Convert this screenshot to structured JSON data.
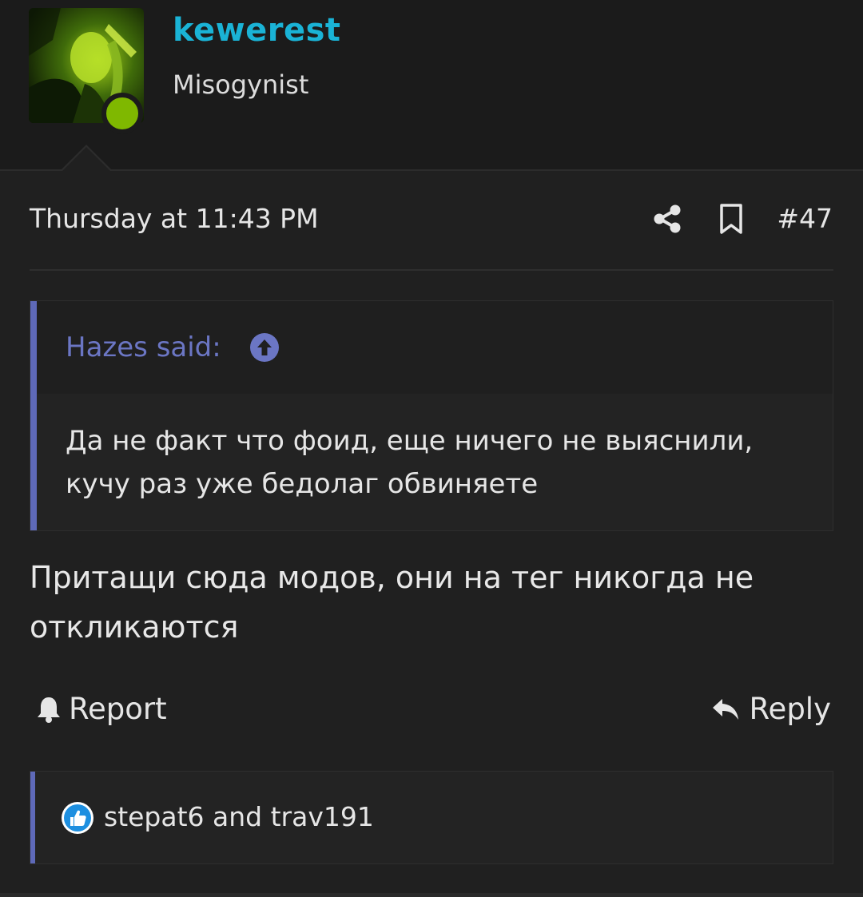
{
  "user": {
    "name": "kewerest",
    "title": "Misogynist",
    "status": "online",
    "status_color": "#7fb800",
    "name_color": "#1ab3d6"
  },
  "post": {
    "date": "Thursday at 11:43 PM",
    "number": "#47",
    "share_icon": "share-icon",
    "bookmark_icon": "bookmark-icon",
    "quote": {
      "author_label": "Hazes said:",
      "jump_icon": "arrow-up-circle-icon",
      "text": "Да не факт что фоид, еще ничего не выяснили, кучу раз уже бедолаг обвиняете"
    },
    "message": "Притащи сюда модов, они на тег никогда не откликаются",
    "actions": {
      "report_label": "Report",
      "reply_label": "Reply"
    },
    "reactions": {
      "icon": "like-icon",
      "text": "stepat6 and trav191"
    }
  },
  "colors": {
    "background": "#202020",
    "accent": "#5e69b8",
    "quote_author": "#6b76c4"
  }
}
